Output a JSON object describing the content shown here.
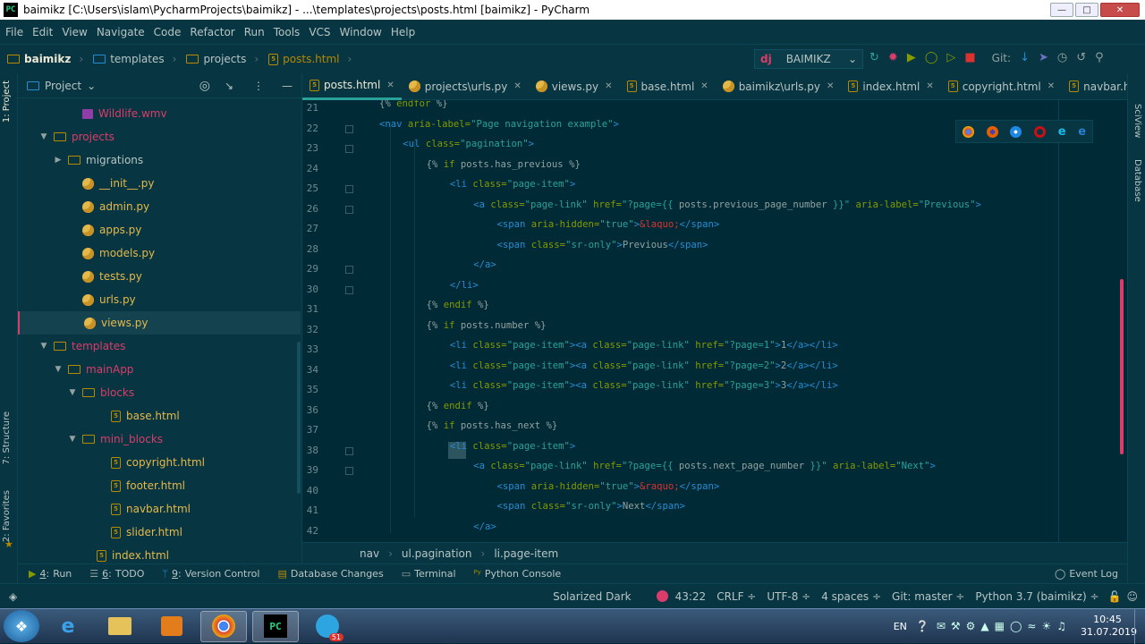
{
  "window": {
    "title": "baimikz [C:\\Users\\islam\\PycharmProjects\\baimikz] - ...\\templates\\projects\\posts.html [baimikz] - PyCharm",
    "app_icon": "PC"
  },
  "menu": [
    "File",
    "Edit",
    "View",
    "Navigate",
    "Code",
    "Refactor",
    "Run",
    "Tools",
    "VCS",
    "Window",
    "Help"
  ],
  "breadcrumbs": [
    "baimikz",
    "templates",
    "projects",
    "posts.html"
  ],
  "run_config": {
    "label": "BAIMIKZ"
  },
  "git_label": "Git:",
  "project_panel": {
    "title": "Project"
  },
  "tree": [
    {
      "label": "Wildlife.wmv",
      "kind": "media",
      "color": "#dc3c6a",
      "indent": 3
    },
    {
      "label": "projects",
      "kind": "folder",
      "color": "#dc3c6a",
      "indent": 1,
      "chev": "down"
    },
    {
      "label": "migrations",
      "kind": "folder",
      "color": "#b8c4c4",
      "indent": 2,
      "chev": "right"
    },
    {
      "label": "__init__.py",
      "kind": "py",
      "color": "#e5b84a",
      "indent": 3
    },
    {
      "label": "admin.py",
      "kind": "py",
      "color": "#e5b84a",
      "indent": 3
    },
    {
      "label": "apps.py",
      "kind": "py",
      "color": "#e5b84a",
      "indent": 3
    },
    {
      "label": "models.py",
      "kind": "py",
      "color": "#e5b84a",
      "indent": 3
    },
    {
      "label": "tests.py",
      "kind": "py",
      "color": "#e5b84a",
      "indent": 3
    },
    {
      "label": "urls.py",
      "kind": "py",
      "color": "#e5b84a",
      "indent": 3
    },
    {
      "label": "views.py",
      "kind": "py",
      "color": "#e5b84a",
      "indent": 3,
      "selected": true
    },
    {
      "label": "templates",
      "kind": "folder",
      "color": "#dc3c6a",
      "indent": 1,
      "chev": "down"
    },
    {
      "label": "mainApp",
      "kind": "folder",
      "color": "#dc3c6a",
      "indent": 2,
      "chev": "down"
    },
    {
      "label": "blocks",
      "kind": "folder",
      "color": "#dc3c6a",
      "indent": 3,
      "chev": "down"
    },
    {
      "label": "base.html",
      "kind": "html",
      "color": "#e5b84a",
      "indent": 5
    },
    {
      "label": "mini_blocks",
      "kind": "folder",
      "color": "#dc3c6a",
      "indent": 3,
      "chev": "down"
    },
    {
      "label": "copyright.html",
      "kind": "html",
      "color": "#e5b84a",
      "indent": 5
    },
    {
      "label": "footer.html",
      "kind": "html",
      "color": "#e5b84a",
      "indent": 5
    },
    {
      "label": "navbar.html",
      "kind": "html",
      "color": "#e5b84a",
      "indent": 5
    },
    {
      "label": "slider.html",
      "kind": "html",
      "color": "#e5b84a",
      "indent": 5
    },
    {
      "label": "index.html",
      "kind": "html",
      "color": "#e5b84a",
      "indent": 4
    }
  ],
  "tabs": [
    {
      "label": "posts.html",
      "kind": "html",
      "active": true
    },
    {
      "label": "projects\\urls.py",
      "kind": "py"
    },
    {
      "label": "views.py",
      "kind": "py"
    },
    {
      "label": "base.html",
      "kind": "html"
    },
    {
      "label": "baimikz\\urls.py",
      "kind": "py"
    },
    {
      "label": "index.html",
      "kind": "html"
    },
    {
      "label": "copyright.html",
      "kind": "html"
    },
    {
      "label": "navbar.html",
      "kind": "html"
    }
  ],
  "code": [
    {
      "n": "21",
      "ind": 0,
      "t": [
        [
          "dj",
          "{% "
        ],
        [
          "kw",
          "endfor"
        ],
        [
          "dj",
          " %}"
        ]
      ]
    },
    {
      "n": "22",
      "ind": 0,
      "t": [
        [
          "tg",
          "<nav "
        ],
        [
          "at",
          "aria-label="
        ],
        [
          "st",
          "\"Page navigation example\""
        ],
        [
          "tg",
          ">"
        ]
      ]
    },
    {
      "n": "23",
      "ind": 1,
      "t": [
        [
          "tg",
          "<ul "
        ],
        [
          "at",
          "class="
        ],
        [
          "st",
          "\"pagination\""
        ],
        [
          "tg",
          ">"
        ]
      ]
    },
    {
      "n": "24",
      "ind": 2,
      "t": [
        [
          "dj",
          "{% "
        ],
        [
          "kw",
          "if "
        ],
        [
          "tx",
          "posts.has_previous"
        ],
        [
          "dj",
          " %}"
        ]
      ]
    },
    {
      "n": "25",
      "ind": 3,
      "t": [
        [
          "tg",
          "<li "
        ],
        [
          "at",
          "class="
        ],
        [
          "st",
          "\"page-item\""
        ],
        [
          "tg",
          ">"
        ]
      ]
    },
    {
      "n": "26",
      "ind": 4,
      "t": [
        [
          "tg",
          "<a "
        ],
        [
          "at",
          "class="
        ],
        [
          "st",
          "\"page-link\" "
        ],
        [
          "at",
          "href="
        ],
        [
          "st",
          "\"?page={{ "
        ],
        [
          "tx",
          "posts.previous_page_number"
        ],
        [
          "st",
          " }}\" "
        ],
        [
          "at",
          "aria-label="
        ],
        [
          "st",
          "\"Previous\""
        ],
        [
          "tg",
          ">"
        ]
      ]
    },
    {
      "n": "27",
      "ind": 5,
      "t": [
        [
          "tg",
          "<span "
        ],
        [
          "at",
          "aria-hidden="
        ],
        [
          "st",
          "\"true\""
        ],
        [
          "tg",
          ">"
        ],
        [
          "en",
          "&laquo;"
        ],
        [
          "tg",
          "</span>"
        ]
      ]
    },
    {
      "n": "28",
      "ind": 5,
      "t": [
        [
          "tg",
          "<span "
        ],
        [
          "at",
          "class="
        ],
        [
          "st",
          "\"sr-only\""
        ],
        [
          "tg",
          ">"
        ],
        [
          "tx",
          "Previous"
        ],
        [
          "tg",
          "</span>"
        ]
      ]
    },
    {
      "n": "29",
      "ind": 4,
      "t": [
        [
          "tg",
          "</a>"
        ]
      ]
    },
    {
      "n": "30",
      "ind": 3,
      "t": [
        [
          "tg",
          "</li>"
        ]
      ]
    },
    {
      "n": "31",
      "ind": 2,
      "t": [
        [
          "dj",
          "{% "
        ],
        [
          "kw",
          "endif"
        ],
        [
          "dj",
          " %}"
        ]
      ]
    },
    {
      "n": "32",
      "ind": 2,
      "t": [
        [
          "dj",
          "{% "
        ],
        [
          "kw",
          "if "
        ],
        [
          "tx",
          "posts.number"
        ],
        [
          "dj",
          " %}"
        ]
      ]
    },
    {
      "n": "33",
      "ind": 3,
      "t": [
        [
          "tg",
          "<li "
        ],
        [
          "at",
          "class="
        ],
        [
          "st",
          "\"page-item\""
        ],
        [
          "tg",
          ">"
        ],
        [
          "tg",
          "<a "
        ],
        [
          "at",
          "class="
        ],
        [
          "st",
          "\"page-link\" "
        ],
        [
          "at",
          "href="
        ],
        [
          "st",
          "\"?page=1\""
        ],
        [
          "tg",
          ">"
        ],
        [
          "tx",
          "1"
        ],
        [
          "tg",
          "</a></li>"
        ]
      ]
    },
    {
      "n": "34",
      "ind": 3,
      "t": [
        [
          "tg",
          "<li "
        ],
        [
          "at",
          "class="
        ],
        [
          "st",
          "\"page-item\""
        ],
        [
          "tg",
          ">"
        ],
        [
          "tg",
          "<a "
        ],
        [
          "at",
          "class="
        ],
        [
          "st",
          "\"page-link\" "
        ],
        [
          "at",
          "href="
        ],
        [
          "st",
          "\"?page=2\""
        ],
        [
          "tg",
          ">"
        ],
        [
          "tx",
          "2"
        ],
        [
          "tg",
          "</a></li>"
        ]
      ]
    },
    {
      "n": "35",
      "ind": 3,
      "t": [
        [
          "tg",
          "<li "
        ],
        [
          "at",
          "class="
        ],
        [
          "st",
          "\"page-item\""
        ],
        [
          "tg",
          ">"
        ],
        [
          "tg",
          "<a "
        ],
        [
          "at",
          "class="
        ],
        [
          "st",
          "\"page-link\" "
        ],
        [
          "at",
          "href="
        ],
        [
          "st",
          "\"?page=3\""
        ],
        [
          "tg",
          ">"
        ],
        [
          "tx",
          "3"
        ],
        [
          "tg",
          "</a></li>"
        ]
      ]
    },
    {
      "n": "36",
      "ind": 2,
      "t": [
        [
          "dj",
          "{% "
        ],
        [
          "kw",
          "endif"
        ],
        [
          "dj",
          " %}"
        ]
      ]
    },
    {
      "n": "37",
      "ind": 2,
      "t": [
        [
          "dj",
          "{% "
        ],
        [
          "kw",
          "if "
        ],
        [
          "tx",
          "posts.has_next"
        ],
        [
          "dj",
          " %}"
        ]
      ]
    },
    {
      "n": "38",
      "ind": 3,
      "t": [
        [
          "tg",
          "<li "
        ],
        [
          "at",
          "class="
        ],
        [
          "st",
          "\"page-item\""
        ],
        [
          "tg",
          ">"
        ]
      ]
    },
    {
      "n": "39",
      "ind": 4,
      "t": [
        [
          "tg",
          "<a "
        ],
        [
          "at",
          "class="
        ],
        [
          "st",
          "\"page-link\" "
        ],
        [
          "at",
          "href="
        ],
        [
          "st",
          "\"?page={{ "
        ],
        [
          "tx",
          "posts.next_page_number"
        ],
        [
          "st",
          " }}\" "
        ],
        [
          "at",
          "aria-label="
        ],
        [
          "st",
          "\"Next\""
        ],
        [
          "tg",
          ">"
        ]
      ]
    },
    {
      "n": "40",
      "ind": 5,
      "t": [
        [
          "tg",
          "<span "
        ],
        [
          "at",
          "aria-hidden="
        ],
        [
          "st",
          "\"true\""
        ],
        [
          "tg",
          ">"
        ],
        [
          "en",
          "&raquo;"
        ],
        [
          "tg",
          "</span>"
        ]
      ]
    },
    {
      "n": "41",
      "ind": 5,
      "t": [
        [
          "tg",
          "<span "
        ],
        [
          "at",
          "class="
        ],
        [
          "st",
          "\"sr-only\""
        ],
        [
          "tg",
          ">"
        ],
        [
          "tx",
          "Next"
        ],
        [
          "tg",
          "</span>"
        ]
      ]
    },
    {
      "n": "42",
      "ind": 4,
      "t": [
        [
          "tg",
          "</a>"
        ]
      ]
    }
  ],
  "code_crumbs": [
    "nav",
    "ul.pagination",
    "li.page-item"
  ],
  "left_strip": {
    "project": "1: Project",
    "structure": "7: Structure",
    "favorites": "2: Favorites"
  },
  "right_strip": {
    "sciview": "SciView",
    "database": "Database"
  },
  "tool_windows": [
    {
      "num": "4",
      "label": "Run",
      "icon": "run-icon"
    },
    {
      "num": "6",
      "label": "TODO",
      "icon": "todo-icon"
    },
    {
      "num": "9",
      "label": "Version Control",
      "icon": "vcs-icon"
    },
    {
      "num": "",
      "label": "Database Changes",
      "icon": "database-icon"
    },
    {
      "num": "",
      "label": "Terminal",
      "icon": "terminal-icon"
    },
    {
      "num": "",
      "label": "Python Console",
      "icon": "python-console-icon"
    }
  ],
  "event_log": "Event Log",
  "status": {
    "theme": "Solarized Dark",
    "position": "43:22",
    "line_sep": "CRLF ÷",
    "encoding": "UTF-8 ÷",
    "indent": "4 spaces ÷",
    "git": "Git: master ÷",
    "interpreter": "Python 3.7 (baimikz) ÷"
  },
  "taskbar": {
    "lang": "EN",
    "time": "10:45",
    "date": "31.07.2019",
    "telegram_badge": "51"
  },
  "colors": {
    "bg": "#002b36",
    "panel": "#073642",
    "accent": "#2aa198",
    "pink": "#dc3c6a",
    "yellow": "#b58900"
  }
}
